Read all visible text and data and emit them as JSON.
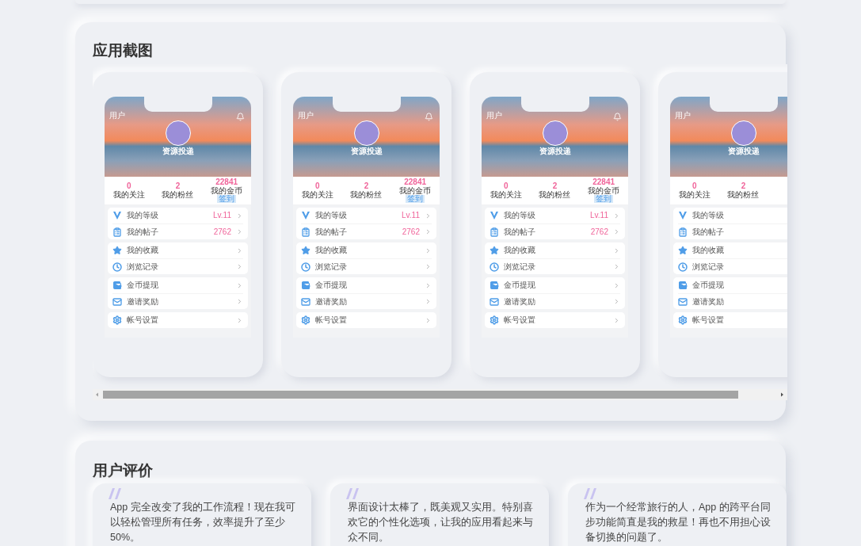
{
  "screens_section": {
    "title": "应用截图",
    "screenshots": [
      {
        "header_title": "用户",
        "bell": true,
        "user_name": "资源投递",
        "stats": [
          {
            "value": "0",
            "label": "我的关注"
          },
          {
            "value": "2",
            "label": "我的粉丝"
          },
          {
            "value": "22841",
            "label": "我的金币",
            "badge": "签到"
          }
        ],
        "menu_groups": [
          [
            {
              "kind": "v",
              "label": "我的等级",
              "value": "Lv.11",
              "chevron": true
            },
            {
              "kind": "clipboard",
              "label": "我的帖子",
              "value": "2762",
              "chevron": true
            }
          ],
          [
            {
              "kind": "star",
              "label": "我的收藏",
              "chevron": true
            },
            {
              "kind": "clock",
              "label": "浏览记录",
              "chevron": true
            }
          ],
          [
            {
              "kind": "wallet",
              "label": "金币提现",
              "chevron": true
            },
            {
              "kind": "mail",
              "label": "邀请奖励",
              "chevron": true
            }
          ],
          [
            {
              "kind": "gear",
              "label": "帐号设置",
              "chevron": true
            }
          ]
        ]
      },
      {
        "header_title": "用户",
        "bell": true,
        "user_name": "资源投递",
        "stats": [
          {
            "value": "0",
            "label": "我的关注"
          },
          {
            "value": "2",
            "label": "我的粉丝"
          },
          {
            "value": "22841",
            "label": "我的金币",
            "badge": "签到"
          }
        ],
        "menu_groups": [
          [
            {
              "kind": "v",
              "label": "我的等级",
              "value": "Lv.11",
              "chevron": true
            },
            {
              "kind": "clipboard",
              "label": "我的帖子",
              "value": "2762",
              "chevron": true
            }
          ],
          [
            {
              "kind": "star",
              "label": "我的收藏",
              "chevron": true
            },
            {
              "kind": "clock",
              "label": "浏览记录",
              "chevron": true
            }
          ],
          [
            {
              "kind": "wallet",
              "label": "金币提现",
              "chevron": true
            },
            {
              "kind": "mail",
              "label": "邀请奖励",
              "chevron": true
            }
          ],
          [
            {
              "kind": "gear",
              "label": "帐号设置",
              "chevron": true
            }
          ]
        ]
      },
      {
        "header_title": "用户",
        "bell": true,
        "user_name": "资源投递",
        "stats": [
          {
            "value": "0",
            "label": "我的关注"
          },
          {
            "value": "2",
            "label": "我的粉丝"
          },
          {
            "value": "22841",
            "label": "我的金币",
            "badge": "签到"
          }
        ],
        "menu_groups": [
          [
            {
              "kind": "v",
              "label": "我的等级",
              "value": "Lv.11",
              "chevron": true
            },
            {
              "kind": "clipboard",
              "label": "我的帖子",
              "value": "2762",
              "chevron": true
            }
          ],
          [
            {
              "kind": "star",
              "label": "我的收藏",
              "chevron": true
            },
            {
              "kind": "clock",
              "label": "浏览记录",
              "chevron": true
            }
          ],
          [
            {
              "kind": "wallet",
              "label": "金币提现",
              "chevron": true
            },
            {
              "kind": "mail",
              "label": "邀请奖励",
              "chevron": true
            }
          ],
          [
            {
              "kind": "gear",
              "label": "帐号设置",
              "chevron": true
            }
          ]
        ]
      },
      {
        "header_title": "用户",
        "user_name": "资源投递",
        "stats": [
          {
            "value": "0",
            "label": "我的关注"
          },
          {
            "value": "2",
            "label": "我的粉丝"
          }
        ],
        "menu_groups": [
          [
            {
              "kind": "v",
              "label": "我的等级"
            },
            {
              "kind": "clipboard",
              "label": "我的帖子"
            }
          ],
          [
            {
              "kind": "star",
              "label": "我的收藏"
            },
            {
              "kind": "clock",
              "label": "浏览记录"
            }
          ],
          [
            {
              "kind": "wallet",
              "label": "金币提现"
            },
            {
              "kind": "mail",
              "label": "邀请奖励"
            }
          ],
          [
            {
              "kind": "gear",
              "label": "帐号设置"
            }
          ]
        ]
      }
    ]
  },
  "reviews_section": {
    "title": "用户评价",
    "reviews": [
      {
        "text": "App 完全改变了我的工作流程！现在我可以轻松管理所有任务，效率提升了至少50%。"
      },
      {
        "text": "界面设计太棒了，既美观又实用。特别喜欢它的个性化选项，让我的应用看起来与众不同。"
      },
      {
        "text": "作为一个经常旅行的人，App 的跨平台同步功能简直是我的救星！再也不用担心设备切换的问题了。"
      }
    ]
  }
}
